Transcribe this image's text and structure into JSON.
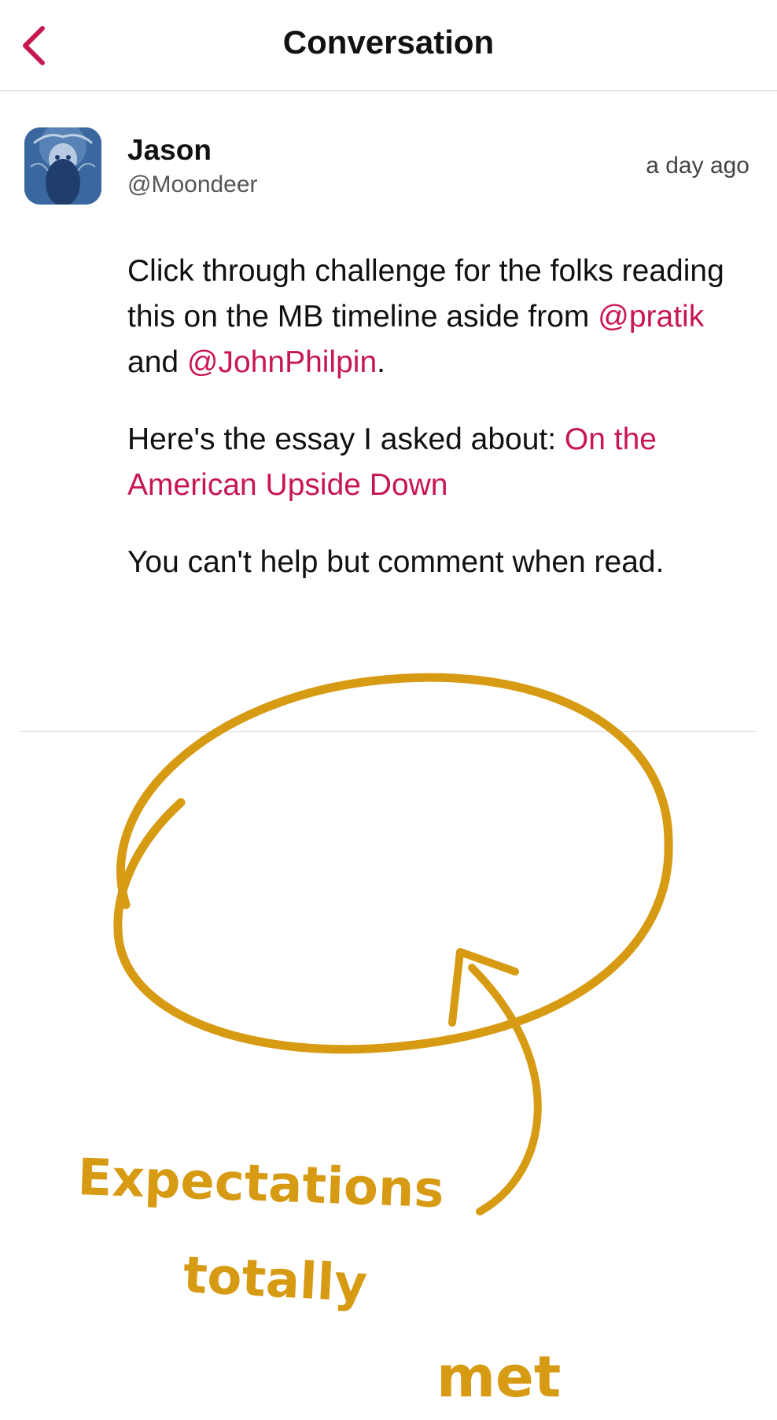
{
  "header": {
    "title": "Conversation",
    "back_icon": "chevron-left-icon"
  },
  "colors": {
    "accent": "#c8174f",
    "annotation": "#d79a13"
  },
  "post": {
    "author_name": "Jason",
    "author_handle": "@Moondeer",
    "timestamp": "a day ago",
    "paragraph1": {
      "text_a": "Click through challenge for the folks reading this on the MB timeline aside from ",
      "mention1": "@pratik",
      "text_b": " and ",
      "mention2": "@JohnPhilpin",
      "text_c": "."
    },
    "paragraph2": {
      "text_a": "Here's the essay I asked about: ",
      "link": "On the American Upside Down"
    },
    "paragraph3": {
      "text": "You can't help but comment when read."
    }
  },
  "annotation": {
    "line1": "Expectations",
    "line2": "totally",
    "line3": "met"
  }
}
